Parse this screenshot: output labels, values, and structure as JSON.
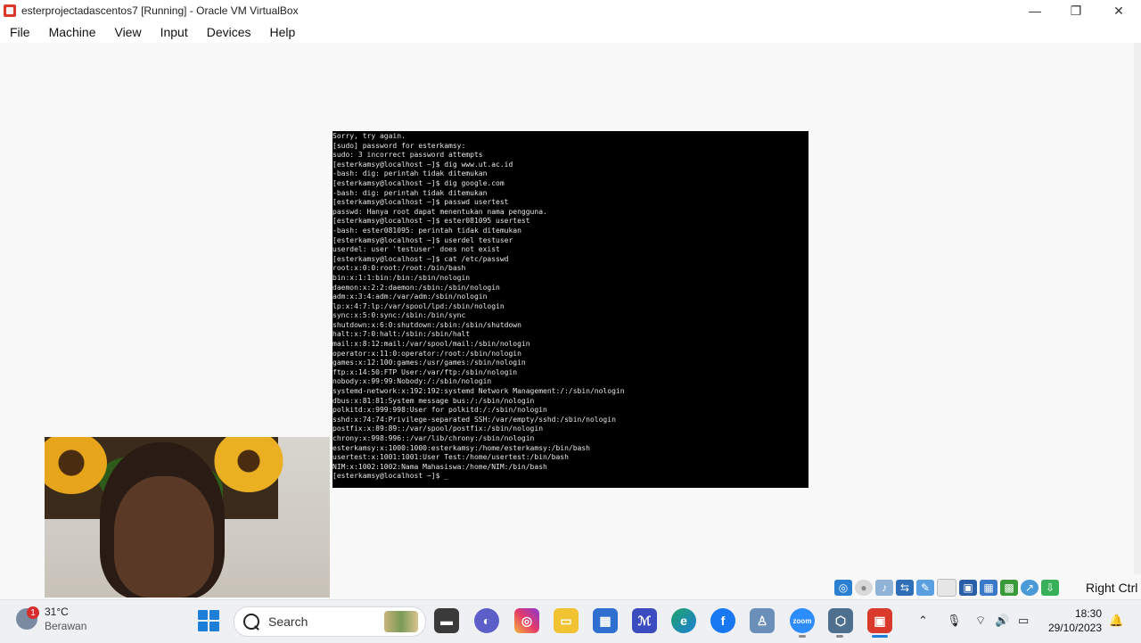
{
  "window": {
    "title": "esterprojectadascentos7 [Running] - Oracle VM VirtualBox",
    "minimize": "—",
    "maximize": "❐",
    "close": "✕"
  },
  "menu": [
    "File",
    "Machine",
    "View",
    "Input",
    "Devices",
    "Help"
  ],
  "terminal": {
    "lines": [
      "Sorry, try again.",
      "[sudo] password for esterkamsy:",
      "sudo: 3 incorrect password attempts",
      "[esterkamsy@localhost ~]$ dig www.ut.ac.id",
      "-bash: dig: perintah tidak ditemukan",
      "[esterkamsy@localhost ~]$ dig google.com",
      "-bash: dig: perintah tidak ditemukan",
      "[esterkamsy@localhost ~]$ passwd usertest",
      "passwd: Hanya root dapat menentukan nama pengguna.",
      "[esterkamsy@localhost ~]$ ester081095 usertest",
      "-bash: ester081095: perintah tidak ditemukan",
      "[esterkamsy@localhost ~]$ userdel testuser",
      "userdel: user 'testuser' does not exist",
      "[esterkamsy@localhost ~]$ cat /etc/passwd",
      "root:x:0:0:root:/root:/bin/bash",
      "bin:x:1:1:bin:/bin:/sbin/nologin",
      "daemon:x:2:2:daemon:/sbin:/sbin/nologin",
      "adm:x:3:4:adm:/var/adm:/sbin/nologin",
      "lp:x:4:7:lp:/var/spool/lpd:/sbin/nologin",
      "sync:x:5:0:sync:/sbin:/bin/sync",
      "shutdown:x:6:0:shutdown:/sbin:/sbin/shutdown",
      "halt:x:7:0:halt:/sbin:/sbin/halt",
      "mail:x:8:12:mail:/var/spool/mail:/sbin/nologin",
      "operator:x:11:0:operator:/root:/sbin/nologin",
      "games:x:12:100:games:/usr/games:/sbin/nologin",
      "ftp:x:14:50:FTP User:/var/ftp:/sbin/nologin",
      "nobody:x:99:99:Nobody:/:/sbin/nologin",
      "systemd-network:x:192:192:systemd Network Management:/:/sbin/nologin",
      "dbus:x:81:81:System message bus:/:/sbin/nologin",
      "polkitd:x:999:998:User for polkitd:/:/sbin/nologin",
      "sshd:x:74:74:Privilege-separated SSH:/var/empty/sshd:/sbin/nologin",
      "postfix:x:89:89::/var/spool/postfix:/sbin/nologin",
      "chrony:x:998:996::/var/lib/chrony:/sbin/nologin",
      "esterkamsy:x:1000:1000:esterkamsy:/home/esterkamsy:/bin/bash",
      "usertest:x:1001:1001:User Test:/home/usertest:/bin/bash",
      "NIM:x:1002:1002:Nama Mahasiswa:/home/NIM:/bin/bash",
      "[esterkamsy@localhost ~]$ _"
    ]
  },
  "statusbar": {
    "host_key": "Right Ctrl"
  },
  "taskbar": {
    "weather_temp": "31°C",
    "weather_desc": "Berawan",
    "weather_badge": "1",
    "search_placeholder": "Search",
    "time": "18:30",
    "date": "29/10/2023"
  },
  "colors": {
    "terminal_bg": "#000000",
    "terminal_fg": "#e6e6e6",
    "start_blue": "#1e7fd8",
    "virtualbox_red": "#d93a2b"
  }
}
